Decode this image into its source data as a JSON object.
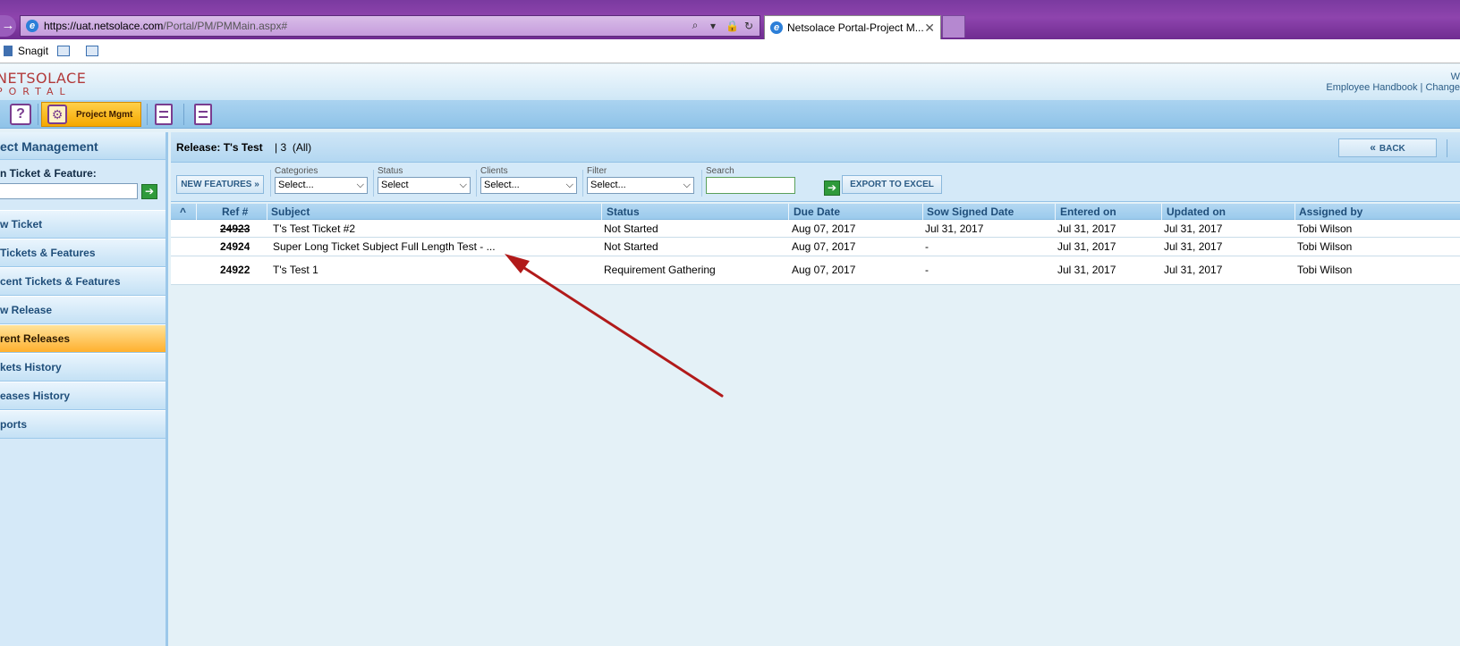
{
  "browser": {
    "url_scheme_host": "https://uat.netsolace.com",
    "url_path": "/Portal/PM/PMMain.aspx#",
    "tab_title": "Netsolace Portal-Project M...",
    "tab_close": "✕",
    "nav_glyph": "→",
    "tools": [
      "⌕",
      "▾",
      "🔒",
      "↻"
    ],
    "favorites": [
      {
        "label": "Snagit"
      },
      {
        "label": ""
      },
      {
        "label": ""
      }
    ]
  },
  "portal": {
    "logo_line1": "NETSOLACE",
    "logo_line2": "PORTAL",
    "header_w": "W",
    "header_links": "Employee Handbook | Change"
  },
  "toolbar": {
    "help_glyph": "?",
    "pm_glyph": "⚙",
    "project_mgmt_label": "Project Mgmt"
  },
  "sidebar": {
    "title": "ect Management",
    "search_label": "n Ticket & Feature:",
    "search_value": "",
    "go_glyph": "➔",
    "items": [
      {
        "label": "w Ticket",
        "active": false
      },
      {
        "label": " Tickets & Features",
        "active": false
      },
      {
        "label": "cent Tickets & Features",
        "active": false
      },
      {
        "label": "w Release",
        "active": false
      },
      {
        "label": "rent Releases",
        "active": true
      },
      {
        "label": "kets History",
        "active": false
      },
      {
        "label": "eases History",
        "active": false
      },
      {
        "label": "ports",
        "active": false
      }
    ]
  },
  "release": {
    "prefix": "Release: T's Test",
    "count": "| 3",
    "scope": "(All)",
    "back_chevron": "«",
    "back_label": "BACK"
  },
  "filters": {
    "new_features_label": "NEW FEATURES »",
    "categories": {
      "caption": "Categories",
      "value": "Select..."
    },
    "status": {
      "caption": "Status",
      "value": "Select"
    },
    "clients": {
      "caption": "Clients",
      "value": "Select..."
    },
    "filter": {
      "caption": "Filter",
      "value": "Select..."
    },
    "search": {
      "caption": "Search",
      "value": ""
    },
    "dropdown_glyph": "⌵",
    "export_label": "EXPORT TO EXCEL"
  },
  "grid": {
    "sort_glyph": "^",
    "columns": [
      "Ref #",
      "Subject",
      "Status",
      "Due Date",
      "Sow Signed Date",
      "Entered on",
      "Updated on",
      "Assigned by"
    ],
    "rows": [
      {
        "ref": "24923",
        "struck": true,
        "subject": "T's Test Ticket #2",
        "status": "Not Started",
        "due": "Aug 07, 2017",
        "sow": "Jul 31, 2017",
        "entered": "Jul 31, 2017",
        "updated": "Jul 31, 2017",
        "assigned": "Tobi Wilson"
      },
      {
        "ref": "24924",
        "struck": false,
        "subject": "Super Long Ticket Subject Full Length Test - ...",
        "status": "Not Started",
        "due": "Aug 07, 2017",
        "sow": "-",
        "entered": "Jul 31, 2017",
        "updated": "Jul 31, 2017",
        "assigned": "Tobi Wilson"
      },
      {
        "ref": "24922",
        "struck": false,
        "subject": "T's Test 1",
        "status": "Requirement Gathering",
        "due": "Aug 07, 2017",
        "sow": "-",
        "entered": "Jul 31, 2017",
        "updated": "Jul 31, 2017",
        "assigned": "Tobi Wilson"
      }
    ]
  },
  "colors": {
    "arrow": "#b11a1a",
    "accent": "#ffb02e",
    "nav_text": "#1f4e7a"
  }
}
